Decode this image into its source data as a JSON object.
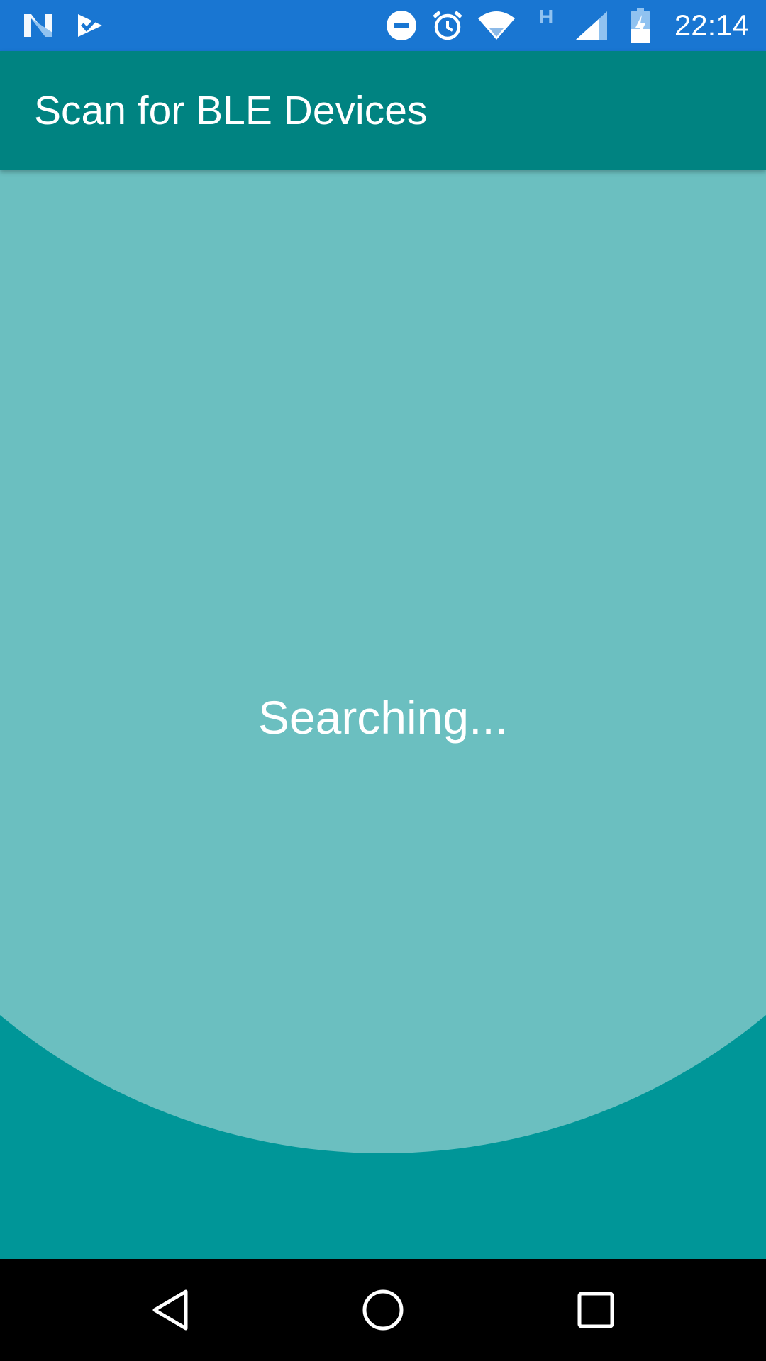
{
  "status_bar": {
    "time": "22:14",
    "network_type": "H",
    "icons": [
      "android-n-icon",
      "task-check-icon",
      "do-not-disturb-icon",
      "alarm-icon",
      "wifi-icon",
      "cell-signal-icon",
      "battery-charging-icon"
    ]
  },
  "app_bar": {
    "title": "Scan for BLE Devices"
  },
  "scan": {
    "status_text": "Searching..."
  },
  "navigation": {
    "buttons": [
      "back-icon",
      "home-icon",
      "recents-icon"
    ]
  },
  "colors": {
    "status_bar": "#1976D2",
    "app_bar": "#008381",
    "background": "#009698",
    "pulse_circle": "#6BBFC0",
    "nav_bar": "#000000"
  }
}
